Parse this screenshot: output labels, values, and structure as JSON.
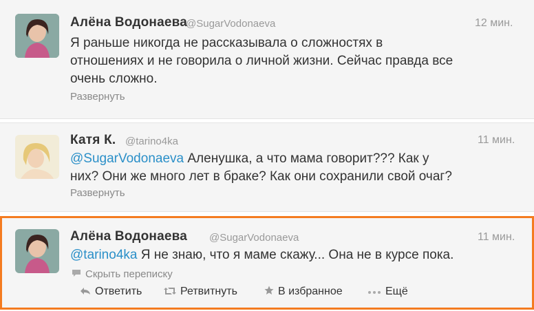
{
  "tweets": [
    {
      "name": "Алёна Водонаева",
      "handle": "@SugarVodonaeva",
      "time": "12 мин.",
      "text_line1": "Я раньше никогда не рассказывала о сложностях в",
      "text_line2": "отношениях и не говорила о личной жизни. Сейчас правда все",
      "text_line3": "очень сложно.",
      "expand": "Развернуть"
    },
    {
      "name": "Катя К.",
      "handle": "@tarino4ka",
      "time": "11 мин.",
      "mention": "@SugarVodonaeva",
      "text_line1": " Аленушка, а что мама говорит??? Как у",
      "text_line2": "них? Они же много лет в браке? Как они сохранили свой очаг?",
      "expand": "Развернуть"
    },
    {
      "name": "Алёна Водонаева",
      "handle": "@SugarVodonaeva",
      "time": "11 мин.",
      "mention": "@tarino4ka",
      "text_line1": " Я не знаю, что я маме скажу... Она не в курсе пока.",
      "hide_conversation": "Скрыть переписку",
      "actions": {
        "reply": "Ответить",
        "retweet": "Ретвитнуть",
        "favorite": "В избранное",
        "more": "Ещё"
      }
    }
  ],
  "colors": {
    "accent": "#f47b20",
    "link": "#2a8fc8",
    "muted": "#999999"
  }
}
